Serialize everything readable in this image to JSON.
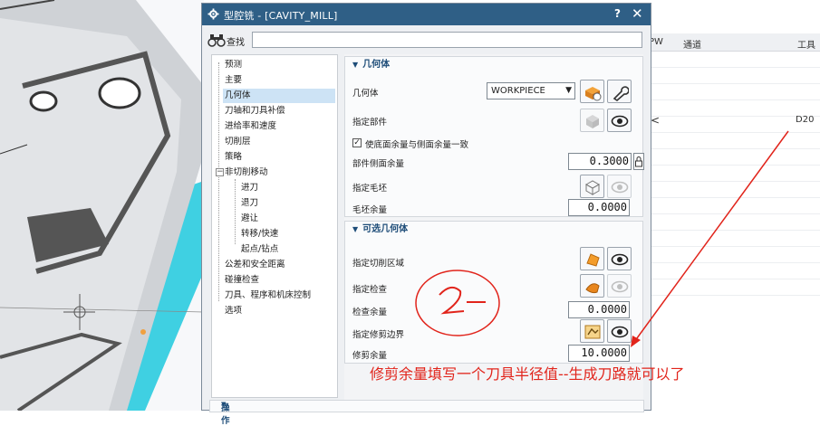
{
  "dialog": {
    "title": "型腔铣 - [CAVITY_MILL]",
    "help_label": "?",
    "close_label": "✕",
    "search_label": "查找",
    "search_value": "",
    "accent_color": "#2f5f86"
  },
  "nav": {
    "items": [
      {
        "label": "预测"
      },
      {
        "label": "主要"
      },
      {
        "label": "几何体"
      },
      {
        "label": "刀轴和刀具补偿"
      },
      {
        "label": "进给率和速度"
      },
      {
        "label": "切削层"
      },
      {
        "label": "策略"
      },
      {
        "label": "非切削移动"
      },
      {
        "label": "进刀"
      },
      {
        "label": "退刀"
      },
      {
        "label": "避让"
      },
      {
        "label": "转移/快速"
      },
      {
        "label": "起点/钻点"
      },
      {
        "label": "公差和安全距离"
      },
      {
        "label": "碰撞检查"
      },
      {
        "label": "刀具、程序和机床控制"
      },
      {
        "label": "选项"
      }
    ],
    "expand_symbol": "−"
  },
  "geometry_group": {
    "title": "几何体",
    "geometry_label": "几何体",
    "geometry_value": "WORKPIECE",
    "specify_part_label": "指定部件",
    "checkbox_label": "使底面余量与侧面余量一致",
    "checkbox_checked": "✓",
    "part_side_stock_label": "部件侧面余量",
    "part_side_stock_value": "0.3000",
    "specify_blank_label": "指定毛坯",
    "blank_stock_label": "毛坯余量",
    "blank_stock_value": "0.0000"
  },
  "optional_group": {
    "title": "可选几何体",
    "specify_cut_area_label": "指定切削区域",
    "specify_check_label": "指定检查",
    "check_stock_label": "检查余量",
    "check_stock_value": "0.0000",
    "specify_trim_label": "指定修剪边界",
    "trim_stock_label": "修剪余量",
    "trim_stock_value": "10.0000"
  },
  "bottom_group": {
    "title": "操作"
  },
  "operation_grid": {
    "col_pw": "PW",
    "col_path": "通道",
    "col_tool": "工具",
    "row_marker": "<",
    "tool_value": "D20"
  },
  "annotation": {
    "text": "修剪余量填写一个刀具半径值--生成刀路就可以了",
    "color": "#e1241b"
  },
  "icons": [
    "gear-icon",
    "binoculars-icon",
    "workpiece-icon",
    "wrench-icon",
    "eye-icon",
    "part-icon",
    "blank-icon",
    "cut-area-icon",
    "check-icon",
    "trim-boundary-icon",
    "lock-icon"
  ]
}
